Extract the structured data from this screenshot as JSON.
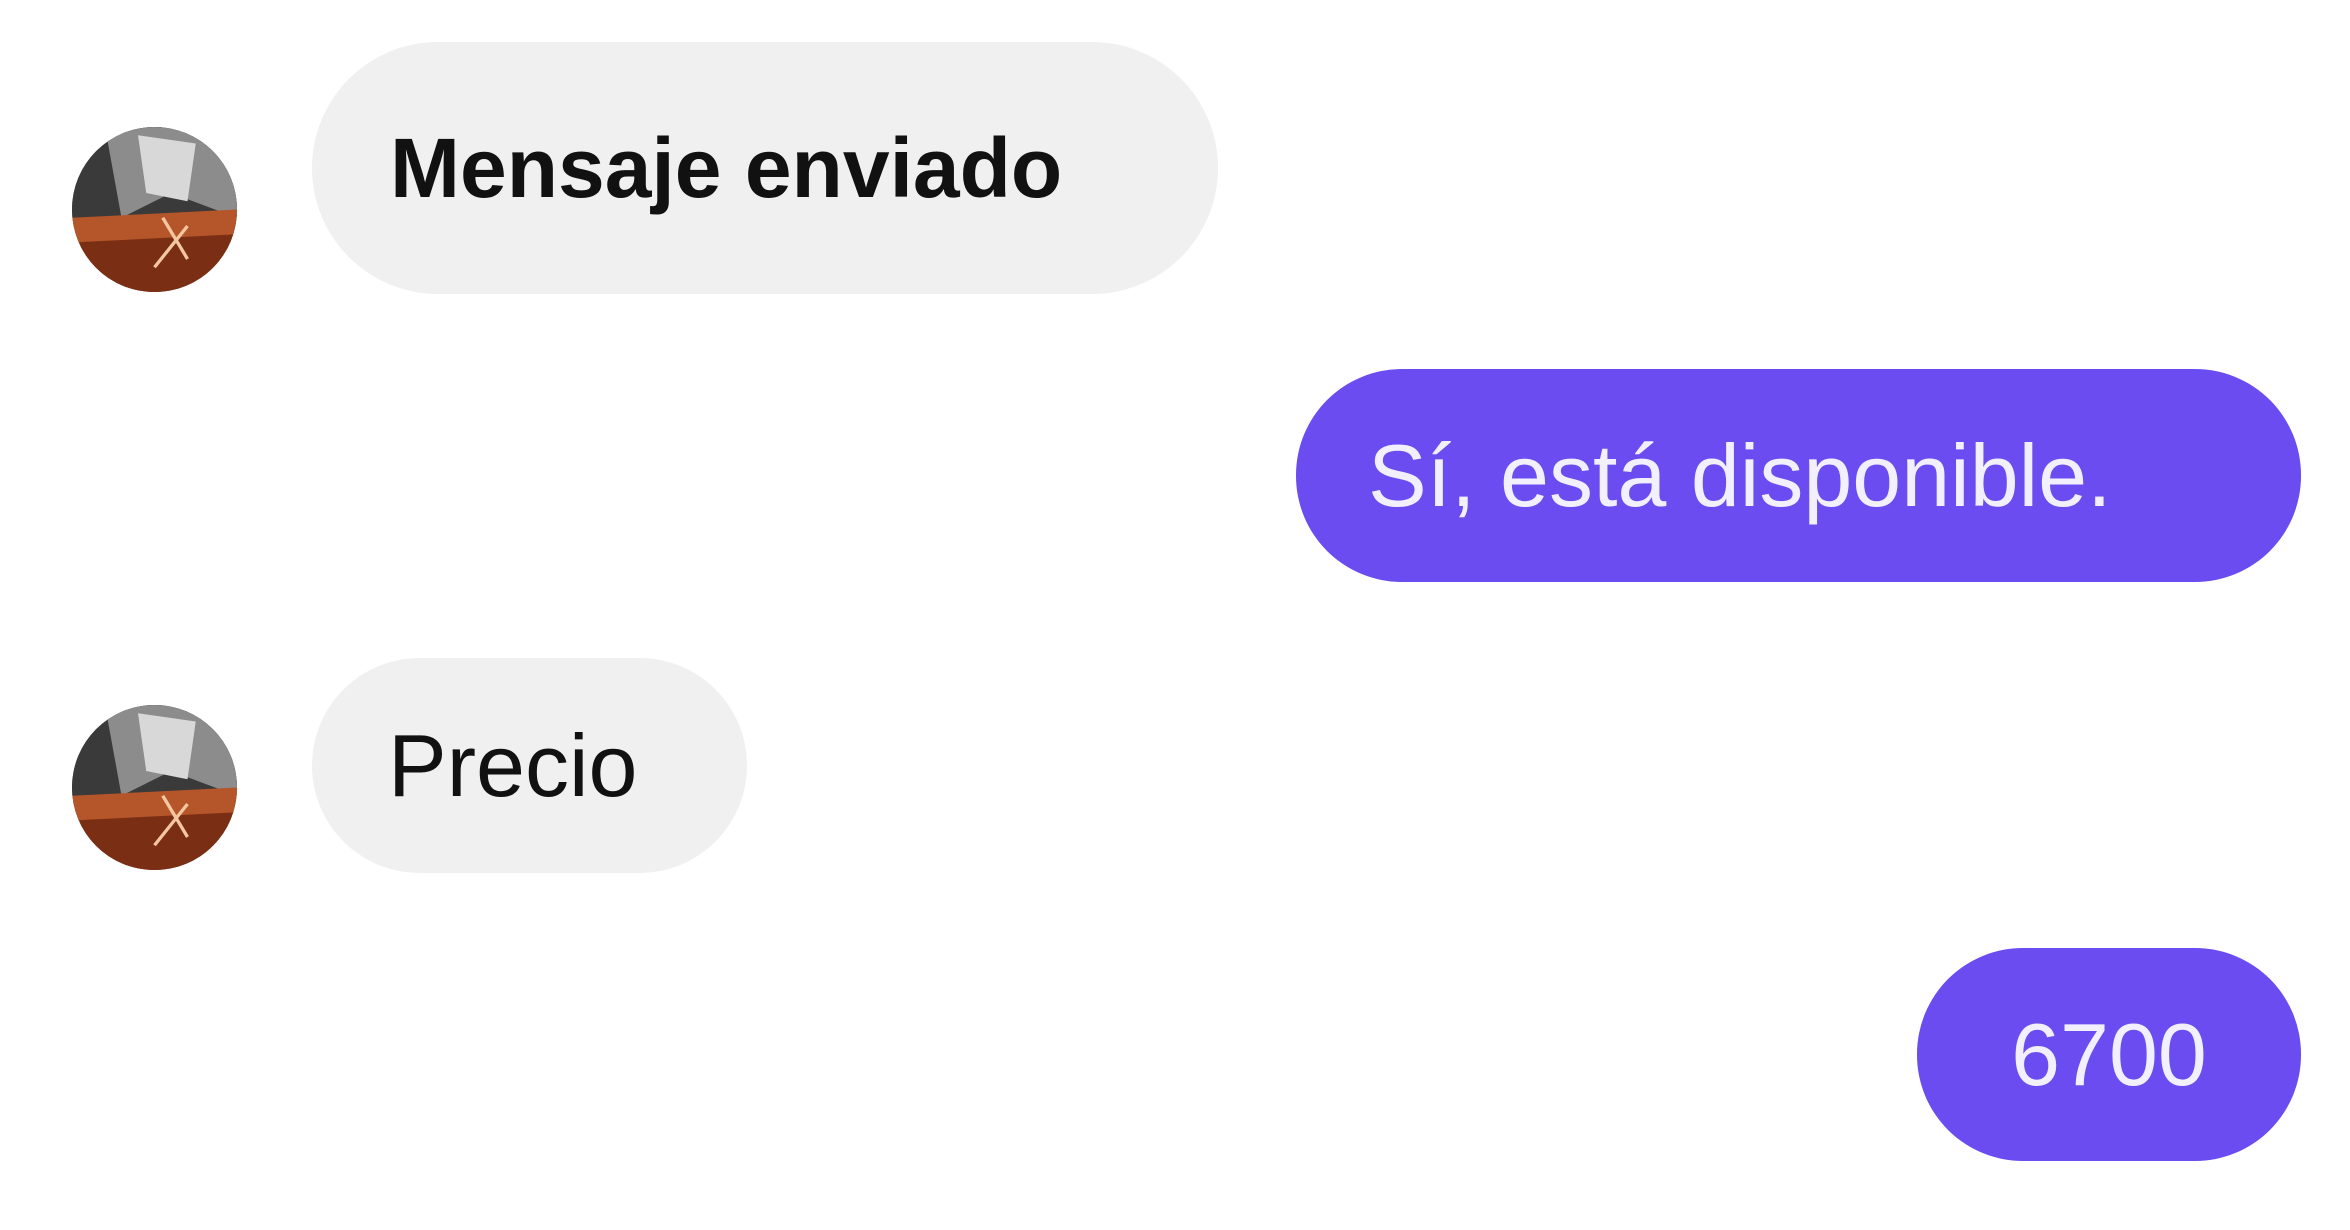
{
  "conversation": {
    "messages": [
      {
        "direction": "incoming",
        "text": "Mensaje enviado"
      },
      {
        "direction": "outgoing",
        "text": "Sí, está disponible."
      },
      {
        "direction": "incoming",
        "text": "Precio"
      },
      {
        "direction": "outgoing",
        "text": "6700"
      }
    ]
  },
  "colors": {
    "incoming_bubble": "#f0f0f0",
    "outgoing_bubble": "#6a4cf0",
    "outgoing_text": "#f2efff",
    "background": "#ffffff"
  },
  "icons": {
    "avatar": "contact-avatar"
  }
}
